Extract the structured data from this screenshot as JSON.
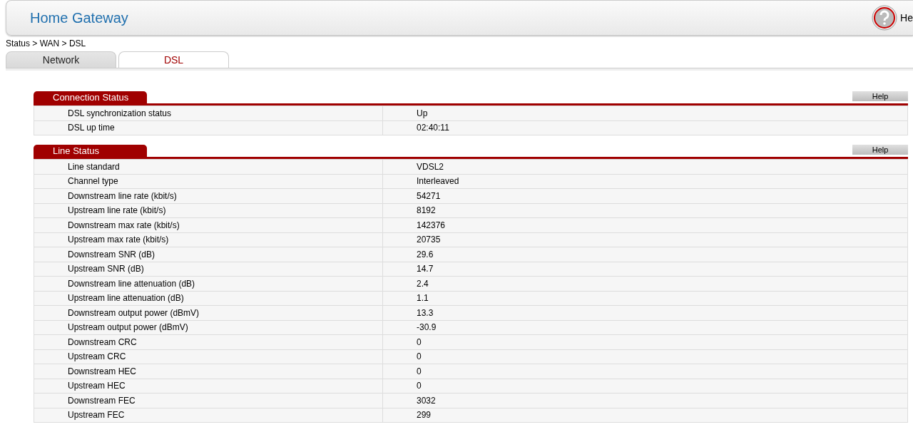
{
  "header": {
    "title": "Home Gateway",
    "help_label": "He"
  },
  "breadcrumb": "Status > WAN > DSL",
  "tabs": [
    {
      "label": "Network",
      "selected": false
    },
    {
      "label": "DSL",
      "selected": true
    }
  ],
  "sections": [
    {
      "title": "Connection Status",
      "help_button": "Help",
      "rows": [
        {
          "label": "DSL synchronization status",
          "value": "Up"
        },
        {
          "label": "DSL up time",
          "value": "02:40:11"
        }
      ]
    },
    {
      "title": "Line Status",
      "help_button": "Help",
      "rows": [
        {
          "label": "Line standard",
          "value": "VDSL2"
        },
        {
          "label": "Channel type",
          "value": "Interleaved"
        },
        {
          "label": "Downstream line rate (kbit/s)",
          "value": "54271"
        },
        {
          "label": "Upstream line rate (kbit/s)",
          "value": "8192"
        },
        {
          "label": "Downstream max rate (kbit/s)",
          "value": "142376"
        },
        {
          "label": "Upstream max rate (kbit/s)",
          "value": "20735"
        },
        {
          "label": "Downstream SNR (dB)",
          "value": "29.6"
        },
        {
          "label": "Upstream SNR (dB)",
          "value": "14.7"
        },
        {
          "label": "Downstream line attenuation (dB)",
          "value": "2.4"
        },
        {
          "label": "Upstream line attenuation (dB)",
          "value": "1.1"
        },
        {
          "label": "Downstream output power (dBmV)",
          "value": "13.3"
        },
        {
          "label": "Upstream output power (dBmV)",
          "value": "-30.9"
        },
        {
          "label": "Downstream CRC",
          "value": "0"
        },
        {
          "label": "Upstream CRC",
          "value": "0"
        },
        {
          "label": "Downstream HEC",
          "value": "0"
        },
        {
          "label": "Upstream HEC",
          "value": "0"
        },
        {
          "label": "Downstream FEC",
          "value": "3032"
        },
        {
          "label": "Upstream FEC",
          "value": "299"
        }
      ]
    }
  ]
}
